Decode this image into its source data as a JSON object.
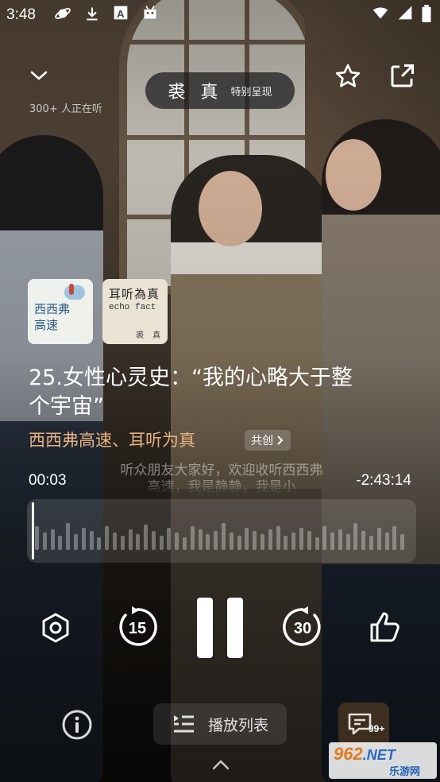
{
  "status_bar": {
    "time": "3:48",
    "left_icons": [
      "planet-icon",
      "download-icon",
      "a-font-icon",
      "robot-icon"
    ],
    "right_icons": [
      "wifi-icon",
      "signal-icon",
      "battery-icon"
    ]
  },
  "header": {
    "listeners": "300+ 人正在听",
    "host_name": "裘 真",
    "host_sub": "特别呈现"
  },
  "covers": [
    {
      "title": "西西弗\n高速"
    },
    {
      "title": "耳听為真",
      "subtitle": "echo fact",
      "author": "裘 真"
    }
  ],
  "episode": {
    "title": "25.女性心灵史：“我的心略大于整个宇宙”",
    "podcasts": "西西弗高速、耳听为真",
    "cocreate_label": "共创"
  },
  "player": {
    "elapsed": "00:03",
    "remaining": "-2:43:14",
    "progress_fraction": 0.0003,
    "transcript": "听众朋友大家好，欢迎收听西西弗高速，我是静静，我是小"
  },
  "controls": {
    "rewind_seconds": "15",
    "forward_seconds": "30"
  },
  "bottom": {
    "playlist_label": "播放列表",
    "comments_badge": "99+"
  },
  "watermark": {
    "logo": "962",
    "domain": ".NET",
    "site": "乐游网"
  }
}
